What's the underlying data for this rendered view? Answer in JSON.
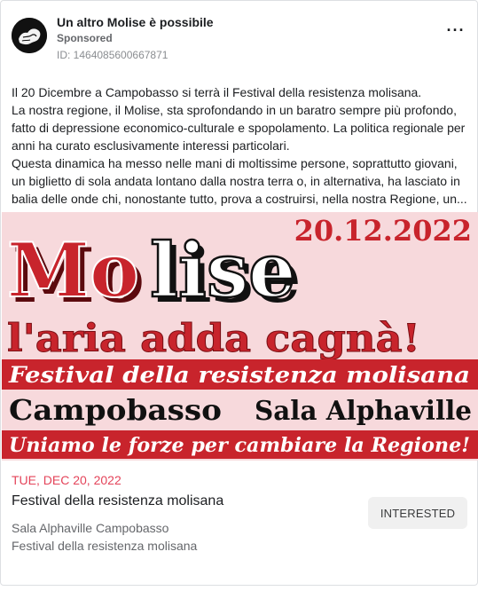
{
  "post": {
    "page_name": "Un altro Molise è possibile",
    "sponsored_label": "Sponsored",
    "ad_id": "ID: 1464085600667871",
    "more_icon": "more-horizontal-icon",
    "body_lines": [
      "Il 20 Dicembre a Campobasso si terrà il Festival della resistenza molisana.",
      "La nostra regione, il Molise, sta sprofondando in un baratro sempre più profondo, fatto di depressione economico-culturale e spopolamento. La politica regionale per anni ha curato esclusivamente interessi particolari.",
      "Questa dinamica ha messo nelle mani di moltissime persone, soprattutto giovani, un biglietto di sola andata lontano dalla nostra terra o, in alternativa, ha lasciato in balia delle onde chi, nonostante tutto, prova a costruirsi, nella nostra Regione, un..."
    ]
  },
  "creative": {
    "date": "20.12.2022",
    "logo_part1": "Mo",
    "logo_part2": "lise",
    "slogan": "l'aria adda cagnà!",
    "festival_banner": "Festival della resistenza molisana",
    "city": "Campobasso",
    "venue": "Sala Alphaville",
    "bottom_banner": "Uniamo le forze per cambiare la Regione!",
    "colors": {
      "background": "#f7d9dc",
      "red": "#c8242c",
      "dark_red": "#8e1218",
      "black": "#111111",
      "white": "#ffffff"
    }
  },
  "event": {
    "date": "TUE, DEC 20, 2022",
    "title": "Festival della resistenza molisana",
    "location": "Sala Alphaville Campobasso",
    "subtitle": "Festival della resistenza molisana",
    "interested_label": "INTERESTED"
  }
}
